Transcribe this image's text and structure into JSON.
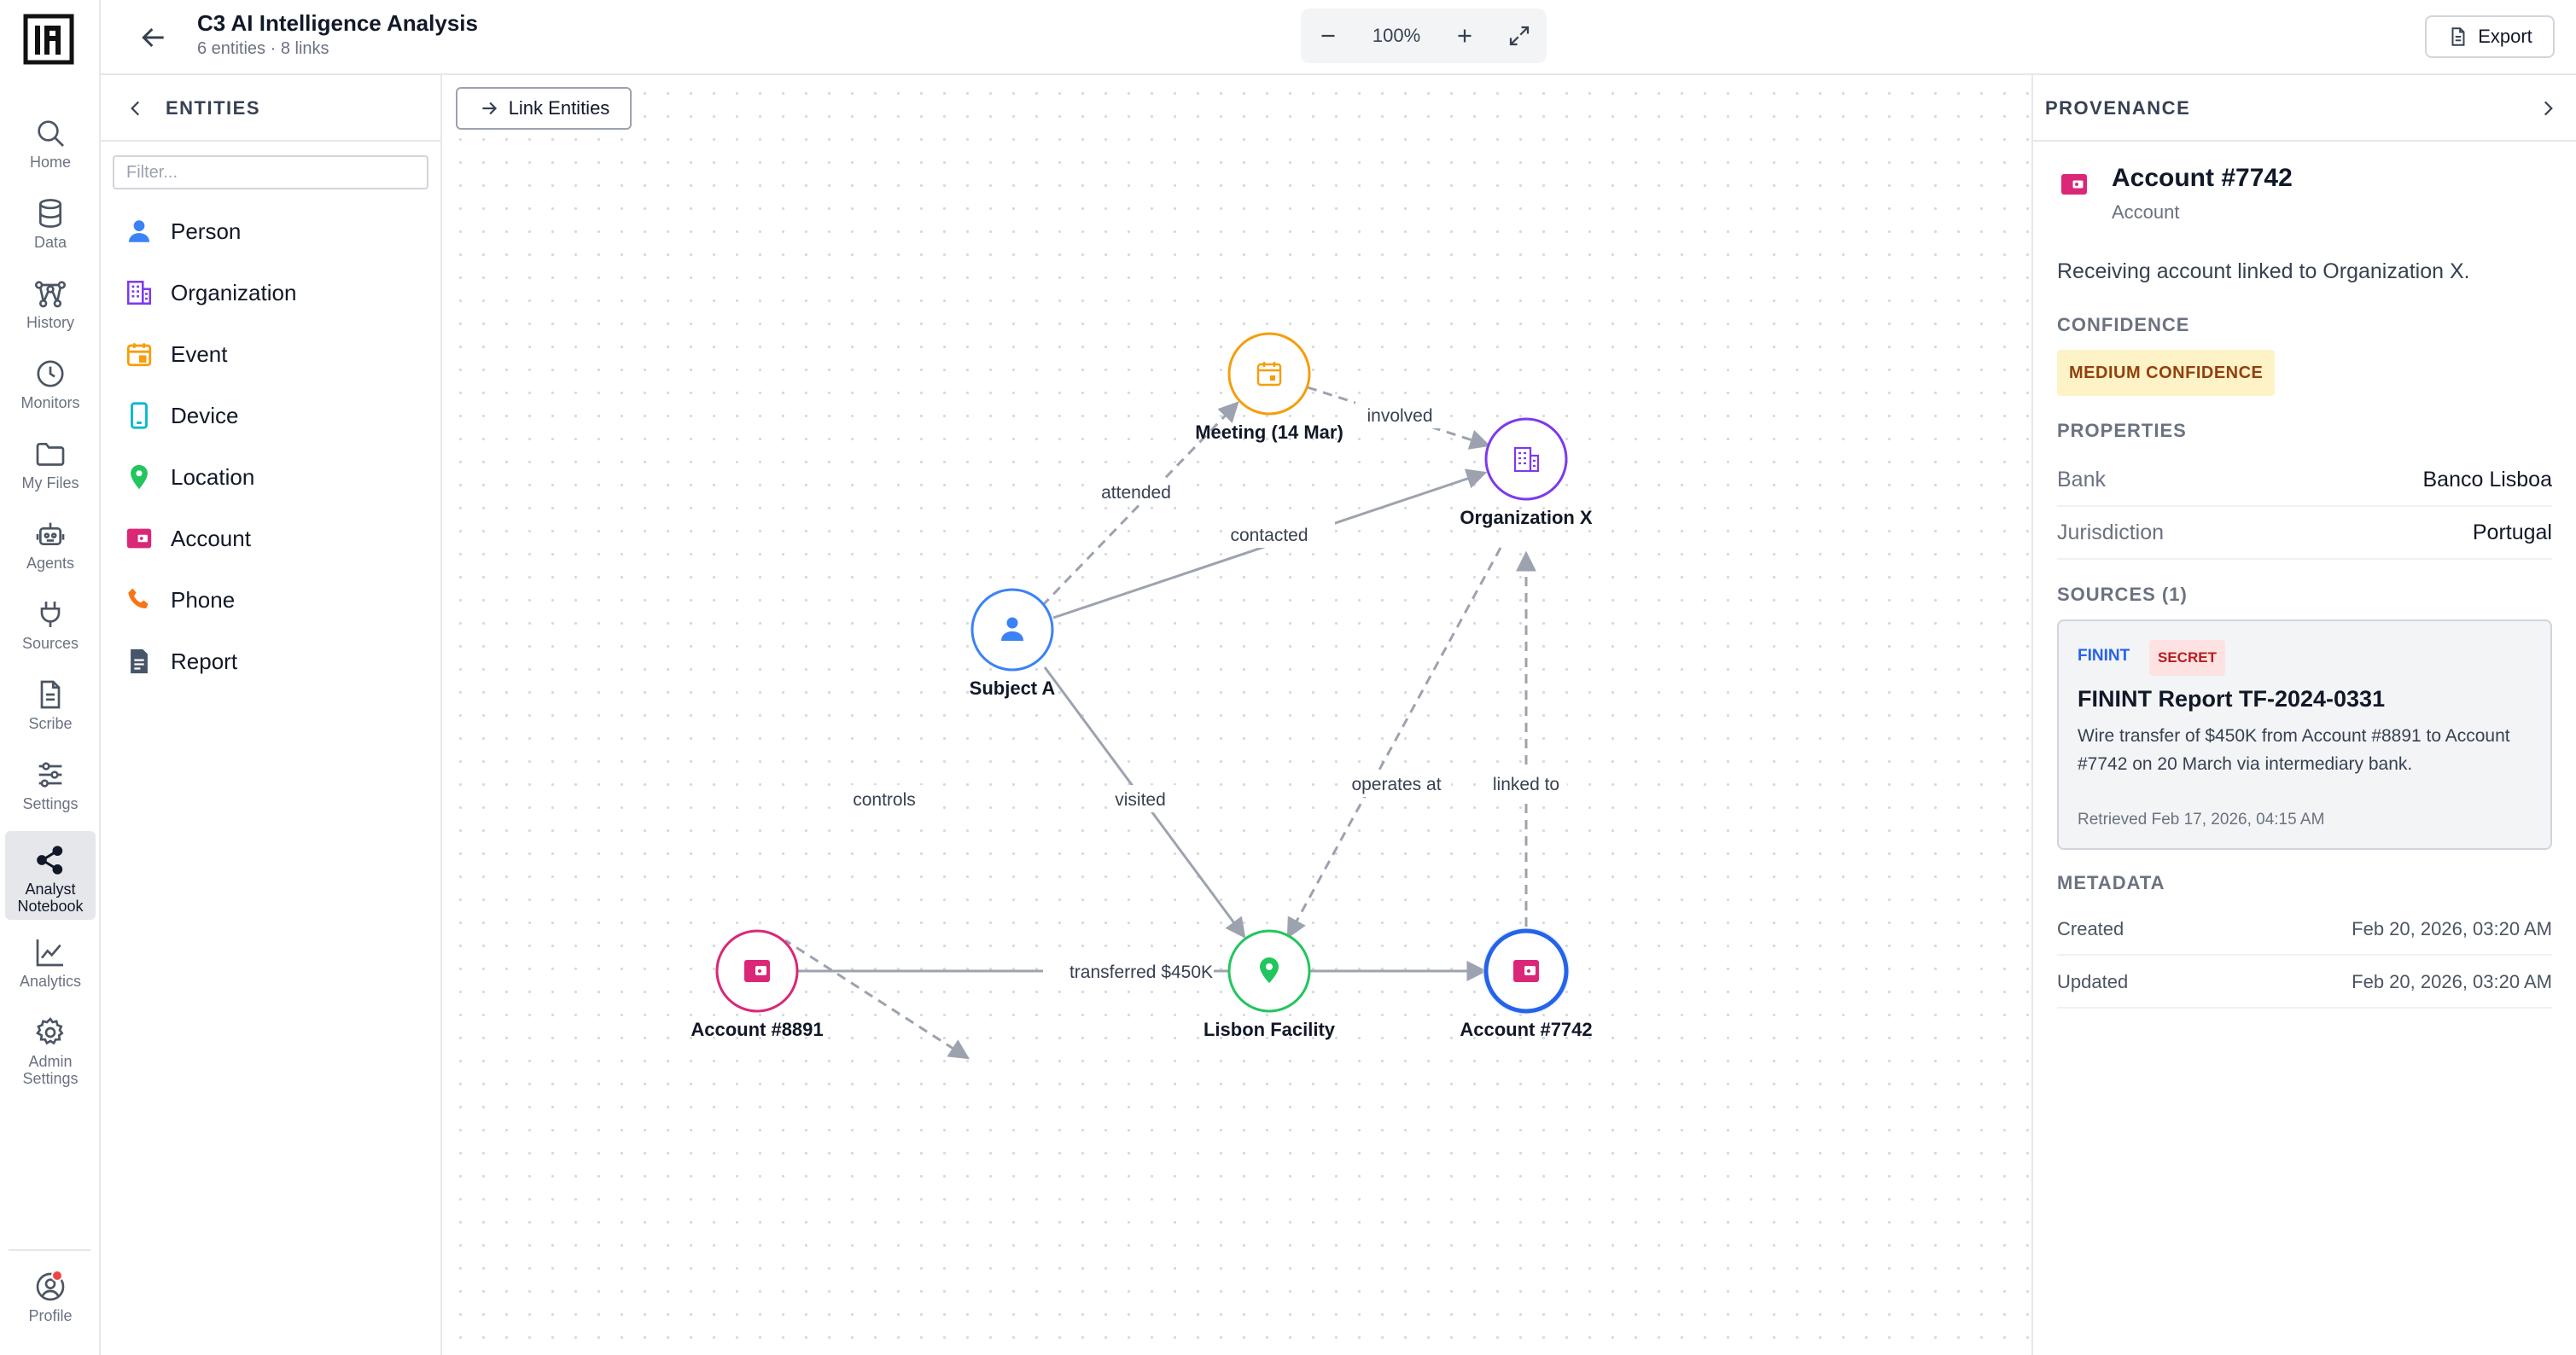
{
  "app": {
    "title": "C3 AI Intelligence Analysis",
    "subtitle": "6 entities · 8 links"
  },
  "nav": {
    "items": [
      {
        "label": "Home",
        "icon": "search-icon"
      },
      {
        "label": "Data",
        "icon": "database-icon"
      },
      {
        "label": "History",
        "icon": "history-graph-icon"
      },
      {
        "label": "Monitors",
        "icon": "clock-icon"
      },
      {
        "label": "My Files",
        "icon": "folder-icon"
      },
      {
        "label": "Agents",
        "icon": "robot-icon"
      },
      {
        "label": "Sources",
        "icon": "plug-icon"
      },
      {
        "label": "Scribe",
        "icon": "document-icon"
      },
      {
        "label": "Settings",
        "icon": "sliders-icon"
      },
      {
        "label": "Analyst Notebook",
        "icon": "share-nodes-icon",
        "active": true
      },
      {
        "label": "Analytics",
        "icon": "chart-line-icon"
      },
      {
        "label": "Admin Settings",
        "icon": "gear-icon"
      }
    ],
    "profile": {
      "label": "Profile",
      "icon": "user-circle-icon"
    }
  },
  "toolbar": {
    "zoom": "100%",
    "export_label": "Export"
  },
  "entities": {
    "heading": "ENTITIES",
    "filter_placeholder": "Filter...",
    "types": [
      {
        "label": "Person",
        "icon": "person-icon",
        "color": "#3b82f6"
      },
      {
        "label": "Organization",
        "icon": "building-icon",
        "color": "#7c3aed"
      },
      {
        "label": "Event",
        "icon": "calendar-icon",
        "color": "#f59e0b"
      },
      {
        "label": "Device",
        "icon": "phone-device-icon",
        "color": "#06b6d4"
      },
      {
        "label": "Location",
        "icon": "map-pin-icon",
        "color": "#22c55e"
      },
      {
        "label": "Account",
        "icon": "wallet-icon",
        "color": "#db2777"
      },
      {
        "label": "Phone",
        "icon": "phone-icon",
        "color": "#f97316"
      },
      {
        "label": "Report",
        "icon": "report-icon",
        "color": "#475569"
      }
    ]
  },
  "canvas": {
    "link_button": "Link Entities",
    "nodes": [
      {
        "id": "meeting",
        "label": "Meeting (14 Mar)",
        "type": "event",
        "color": "#f59e0b"
      },
      {
        "id": "orgx",
        "label": "Organization X",
        "type": "organization",
        "color": "#7c3aed"
      },
      {
        "id": "subject",
        "label": "Subject A",
        "type": "person",
        "color": "#3b82f6"
      },
      {
        "id": "acc8891",
        "label": "Account #8891",
        "type": "account",
        "color": "#db2777"
      },
      {
        "id": "lisbon",
        "label": "Lisbon Facility",
        "type": "location",
        "color": "#22c55e"
      },
      {
        "id": "acc7742",
        "label": "Account #7742",
        "type": "account",
        "color": "#db2777",
        "selected": true
      }
    ],
    "edges": [
      {
        "from": "subject",
        "to": "meeting",
        "label": "attended",
        "dashed": true
      },
      {
        "from": "meeting",
        "to": "orgx",
        "label": "involved",
        "dashed": true
      },
      {
        "from": "subject",
        "to": "orgx",
        "label": "contacted",
        "dashed": false
      },
      {
        "from": "subject",
        "to": "acc8891",
        "label": "controls",
        "dashed": true
      },
      {
        "from": "subject",
        "to": "lisbon",
        "label": "visited",
        "dashed": false
      },
      {
        "from": "orgx",
        "to": "lisbon",
        "label": "operates at",
        "dashed": true
      },
      {
        "from": "acc7742",
        "to": "orgx",
        "label": "linked to",
        "dashed": true
      },
      {
        "from": "acc8891",
        "to": "acc7742",
        "label": "transferred $450K",
        "dashed": false
      }
    ]
  },
  "provenance": {
    "heading": "PROVENANCE",
    "entity_title": "Account #7742",
    "entity_type": "Account",
    "description": "Receiving account linked to Organization X.",
    "confidence_heading": "CONFIDENCE",
    "confidence": "MEDIUM CONFIDENCE",
    "properties_heading": "PROPERTIES",
    "properties": [
      {
        "key": "Bank",
        "value": "Banco Lisboa"
      },
      {
        "key": "Jurisdiction",
        "value": "Portugal"
      }
    ],
    "sources_heading": "SOURCES (1)",
    "source": {
      "tag": "FININT",
      "classification": "SECRET",
      "title": "FININT Report TF-2024-0331",
      "body": "Wire transfer of $450K from Account #8891 to Account #7742 on 20 March via intermediary bank.",
      "retrieved": "Retrieved Feb 17, 2026, 04:15 AM"
    },
    "metadata_heading": "METADATA",
    "metadata": [
      {
        "key": "Created",
        "value": "Feb 20, 2026, 03:20 AM"
      },
      {
        "key": "Updated",
        "value": "Feb 20, 2026, 03:20 AM"
      }
    ]
  }
}
